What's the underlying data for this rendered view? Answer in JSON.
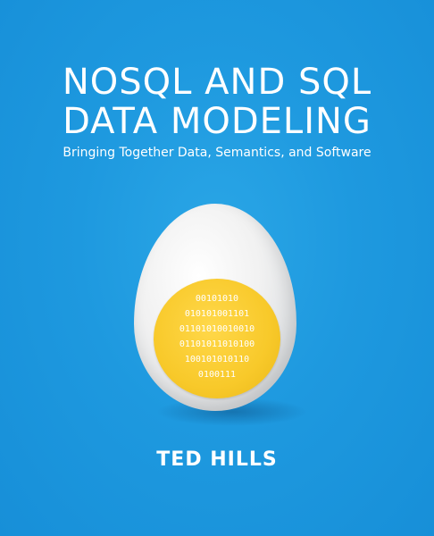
{
  "cover": {
    "title_line1": "NOSQL AND SQL",
    "title_line2": "DATA MODELING",
    "subtitle": "Bringing Together Data, Semantics, and Software",
    "author": "TED HILLS",
    "binary_lines": [
      "00101010",
      "010101001101",
      "01101010010010",
      "01101011010100",
      "100101010110",
      "0100111"
    ]
  },
  "colors": {
    "background": "#1e99df",
    "egg": "#f1f1f1",
    "yolk": "#f8c92a",
    "text": "#ffffff"
  }
}
